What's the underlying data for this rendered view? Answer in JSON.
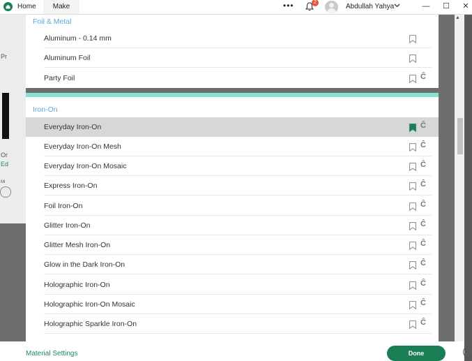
{
  "titlebar": {
    "tab_home": "Home",
    "tab_make": "Make",
    "more": "•••",
    "notifications": "2",
    "username": "Abdullah Yahya",
    "minimize": "—",
    "maximize": "☐",
    "close": "✕"
  },
  "background": {
    "fragments": [
      "Pr",
      "Or",
      "Ed",
      "Mi"
    ]
  },
  "sections": [
    {
      "category": "Foil & Metal",
      "items": [
        {
          "name": "Aluminum - 0.14 mm",
          "bookmarked": false,
          "cut": false
        },
        {
          "name": "Aluminum Foil",
          "bookmarked": false,
          "cut": false
        },
        {
          "name": "Party Foil",
          "bookmarked": false,
          "cut": true
        }
      ]
    },
    {
      "category": "Iron-On",
      "items": [
        {
          "name": "Everyday Iron-On",
          "bookmarked": true,
          "cut": true,
          "selected": true
        },
        {
          "name": "Everyday Iron-On Mesh",
          "bookmarked": false,
          "cut": true
        },
        {
          "name": "Everyday Iron-On Mosaic",
          "bookmarked": false,
          "cut": true
        },
        {
          "name": "Express Iron-On",
          "bookmarked": false,
          "cut": true
        },
        {
          "name": "Foil Iron-On",
          "bookmarked": false,
          "cut": true
        },
        {
          "name": "Glitter Iron-On",
          "bookmarked": false,
          "cut": true
        },
        {
          "name": "Glitter Mesh Iron-On",
          "bookmarked": false,
          "cut": true
        },
        {
          "name": "Glow in the Dark Iron-On",
          "bookmarked": false,
          "cut": true
        },
        {
          "name": "Holographic Iron-On",
          "bookmarked": false,
          "cut": true
        },
        {
          "name": "Holographic Iron-On Mosaic",
          "bookmarked": false,
          "cut": true
        },
        {
          "name": "Holographic Sparkle Iron-On",
          "bookmarked": false,
          "cut": true
        }
      ]
    }
  ],
  "footer": {
    "material_settings": "Material Settings",
    "done": "Done"
  },
  "colors": {
    "accent": "#1a7f55",
    "category": "#5aa9d8",
    "section_bar": "#86e3d4",
    "badge": "#e2563b",
    "selected_row": "#d7d7d7"
  },
  "icons": {
    "bookmark": "bookmark-icon",
    "bookmark_filled": "bookmark-filled-icon",
    "cut": "cut-blade-icon"
  }
}
